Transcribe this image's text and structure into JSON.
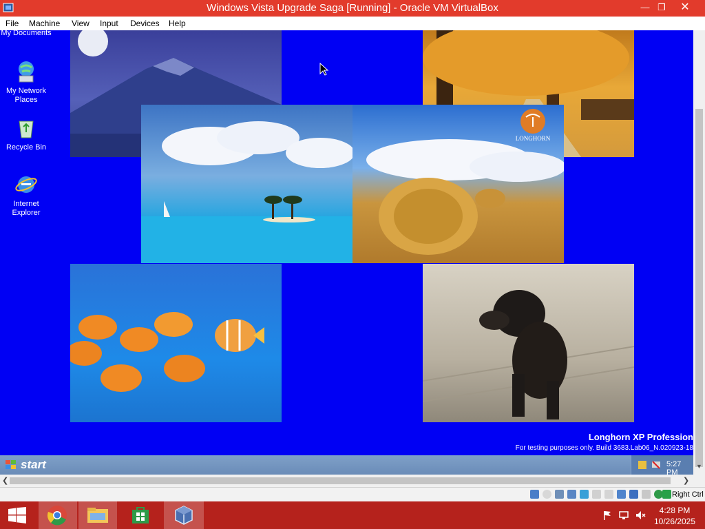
{
  "window": {
    "title": "Windows Vista Upgrade Saga [Running] - Oracle VM VirtualBox",
    "minimize": "—",
    "restore": "❐",
    "close": "✕"
  },
  "menu": [
    "File",
    "Machine",
    "View",
    "Input",
    "Devices",
    "Help"
  ],
  "desktop": {
    "icons": [
      {
        "label": "My Documents",
        "icon": "my-documents-icon"
      },
      {
        "label": "My Network Places",
        "icon": "network-places-icon"
      },
      {
        "label": "Recycle Bin",
        "icon": "recycle-bin-icon"
      },
      {
        "label": "Internet Explorer",
        "icon": "internet-explorer-icon"
      }
    ],
    "branding_title": "Longhorn XP Profession",
    "branding_sub": "For testing purposes only. Build 3683.Lab06_N.020923-18",
    "longhorn_logo_text": "LONGHORN"
  },
  "guest_taskbar": {
    "start_label": "start",
    "clock": "5:27 PM"
  },
  "statusbar": {
    "host_key": "Right Ctrl"
  },
  "host_taskbar": {
    "time": "4:28 PM",
    "date": "10/26/2025"
  },
  "colors": {
    "vbox_title": "#e23b2c",
    "guest_desktop": "#0000f4",
    "host_taskbar": "#b5221c"
  }
}
